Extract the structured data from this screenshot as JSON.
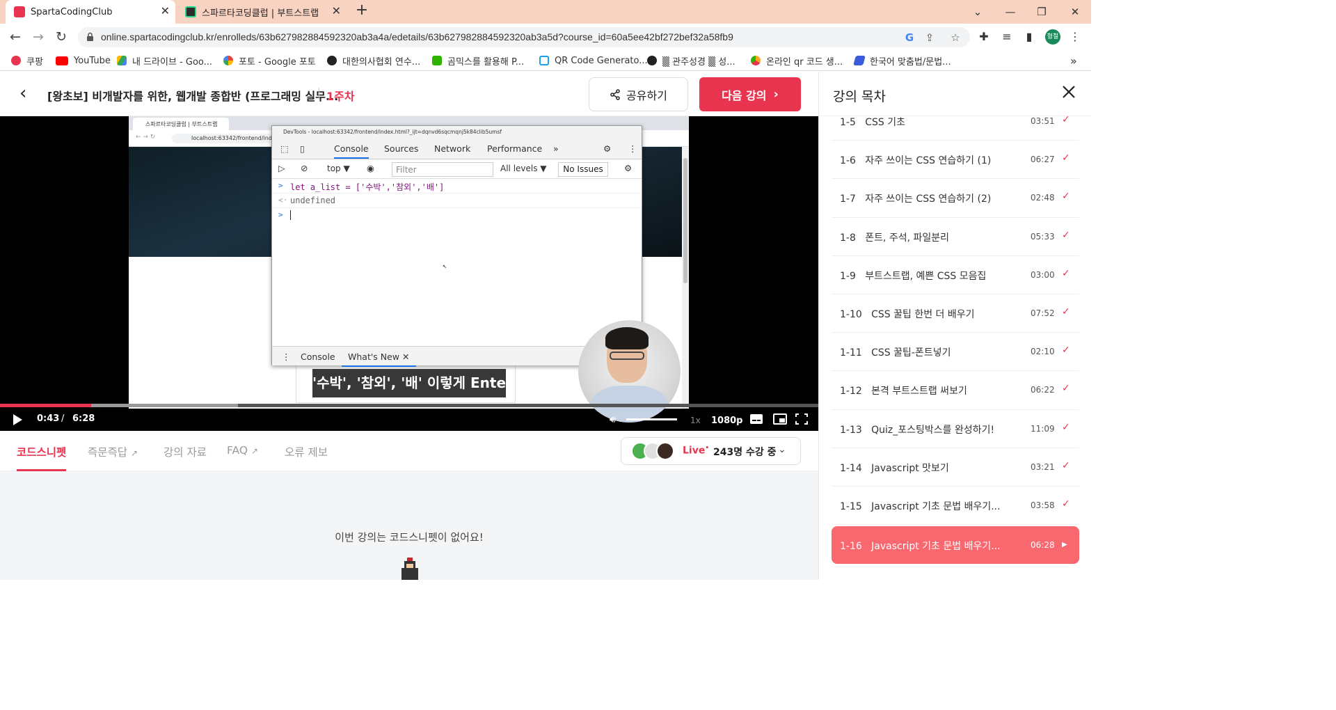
{
  "browser": {
    "tabs": [
      {
        "title": "SpartaCodingClub",
        "active": true,
        "favicon_color": "#e8344e"
      },
      {
        "title": "스파르타코딩클럽 | 부트스트랩",
        "active": false,
        "favicon_color": "#2d2d2d"
      }
    ],
    "new_tab_icon": "plus-icon",
    "url": "online.spartacodingclub.kr/enrolleds/63b627982884592320ab3a4a/edetails/63b627982884592320ab3a5d?course_id=60a5ee42bf272bef32a58fb9",
    "profile_initials": "형철",
    "bookmarks": [
      {
        "label": "쿠팡",
        "icon_color": "#e8344e"
      },
      {
        "label": "YouTube",
        "icon_color": "#ff0000"
      },
      {
        "label": "내 드라이브 - Goo...",
        "icon_color": "#fbbc04"
      },
      {
        "label": "포토 - Google 포토",
        "icon_color": "#ea4335"
      },
      {
        "label": "대한의사협회 연수...",
        "icon_color": "#222222"
      },
      {
        "label": "곰믹스를 활용해 P...",
        "icon_color": "#2db400"
      },
      {
        "label": "QR Code Generato...",
        "icon_color": "#1a9ff0"
      },
      {
        "label": "▒ 관주성경 ▒ 성...",
        "icon_color": "#222222"
      },
      {
        "label": "온라인 qr 코드 생...",
        "icon_color": "#f6a623"
      },
      {
        "label": "한국어 맞춤법/문법...",
        "icon_color": "#3b5bdb"
      }
    ],
    "bookmarks_more": "»"
  },
  "header": {
    "course_title": "[왕초보] 비개발자를 위한, 웹개발 종합반 (프로그래밍 실무...",
    "week": "1주차",
    "share_label": "공유하기",
    "next_label": "다음 강의"
  },
  "video": {
    "inner_browser": {
      "tab_title": "스파르타코딩클럽 | 부트스트랩",
      "url": "localhost:63342/frontend/ind"
    },
    "devtools": {
      "title": "DevTools - localhost:63342/frontend/index.html?_ijt=dqnvd6sqcmqnj5k84clib5umsf",
      "tabs": [
        "Console",
        "Sources",
        "Network",
        "Performance"
      ],
      "more_tabs": "»",
      "context": "top",
      "filter_placeholder": "Filter",
      "levels": "All levels",
      "issues": "No Issues",
      "lines": {
        "input_code": "let a_list = ['수박','참외','배']",
        "output": "undefined"
      },
      "drawer_tabs": [
        "Console",
        "What's New"
      ]
    },
    "subtitle": "'수박', '참외', '배' 이렇게 Enter",
    "current_time": "0:43",
    "time_separator": "/",
    "total_time": "6:28",
    "progress_played": 0.111,
    "progress_buffered": 0.291,
    "volume": 1.0,
    "speed": "1x",
    "quality": "1080p"
  },
  "lower_tabs": [
    {
      "label": "코드스니펫",
      "active": true
    },
    {
      "label": "즉문즉답",
      "external": true
    },
    {
      "label": "강의 자료"
    },
    {
      "label": "FAQ",
      "external": true
    },
    {
      "label": "오류 제보"
    }
  ],
  "live": {
    "label": "Live",
    "viewers": "243명 수강 중"
  },
  "empty_snippet": "이번 강의는 코드스니펫이 없어요!",
  "sidebar": {
    "title": "강의 목차",
    "items": [
      {
        "label": "1-5   CSS 기초",
        "duration": "03:51",
        "done": true
      },
      {
        "label": "1-6   자주 쓰이는 CSS 연습하기 (1)",
        "duration": "06:27",
        "done": true
      },
      {
        "label": "1-7   자주 쓰이는 CSS 연습하기 (2)",
        "duration": "02:48",
        "done": true
      },
      {
        "label": "1-8   폰트, 주석, 파일분리",
        "duration": "05:33",
        "done": true
      },
      {
        "label": "1-9   부트스트랩, 예쁜 CSS 모음집",
        "duration": "03:00",
        "done": true
      },
      {
        "label": "1-10   CSS 꿀팁 한번 더 배우기",
        "duration": "07:52",
        "done": true
      },
      {
        "label": "1-11   CSS 꿀팁-폰트넣기",
        "duration": "02:10",
        "done": true
      },
      {
        "label": "1-12   본격 부트스트랩 써보기",
        "duration": "06:22",
        "done": true
      },
      {
        "label": "1-13   Quiz_포스팅박스를 완성하기!",
        "duration": "11:09",
        "done": true
      },
      {
        "label": "1-14   Javascript 맛보기",
        "duration": "03:21",
        "done": true
      },
      {
        "label": "1-15   Javascript 기초 문법 배우기...",
        "duration": "03:58",
        "done": true
      },
      {
        "label": "1-16   Javascript 기초 문법 배우기...",
        "duration": "06:28",
        "current": true
      }
    ]
  },
  "colors": {
    "brand": "#e8344e",
    "tabbar": "#f9d3c2",
    "current_item": "#f9676f"
  }
}
